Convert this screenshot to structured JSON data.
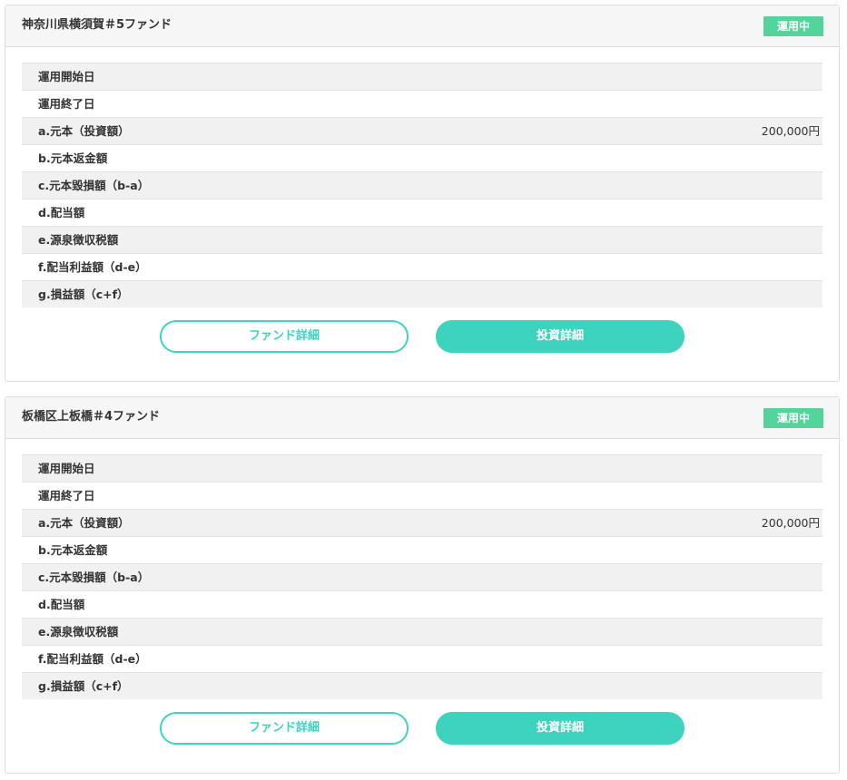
{
  "funds": [
    {
      "title": "神奈川県横須賀＃5ファンド",
      "status": "運用中",
      "rows": [
        {
          "label": "運用開始日",
          "value": ""
        },
        {
          "label": "運用終了日",
          "value": ""
        },
        {
          "label": "a.元本（投資額）",
          "value": "200,000円"
        },
        {
          "label": "b.元本返金額",
          "value": ""
        },
        {
          "label": "c.元本毀損額（b-a）",
          "value": ""
        },
        {
          "label": "d.配当額",
          "value": ""
        },
        {
          "label": "e.源泉徴収税額",
          "value": ""
        },
        {
          "label": "f.配当利益額（d-e）",
          "value": ""
        },
        {
          "label": "g.損益額（c+f）",
          "value": ""
        }
      ],
      "fund_detail_label": "ファンド詳細",
      "investment_detail_label": "投資詳細"
    },
    {
      "title": "板橋区上板橋＃4ファンド",
      "status": "運用中",
      "rows": [
        {
          "label": "運用開始日",
          "value": ""
        },
        {
          "label": "運用終了日",
          "value": ""
        },
        {
          "label": "a.元本（投資額）",
          "value": "200,000円"
        },
        {
          "label": "b.元本返金額",
          "value": ""
        },
        {
          "label": "c.元本毀損額（b-a）",
          "value": ""
        },
        {
          "label": "d.配当額",
          "value": ""
        },
        {
          "label": "e.源泉徴収税額",
          "value": ""
        },
        {
          "label": "f.配当利益額（d-e）",
          "value": ""
        },
        {
          "label": "g.損益額（c+f）",
          "value": ""
        }
      ],
      "fund_detail_label": "ファンド詳細",
      "investment_detail_label": "投資詳細"
    }
  ],
  "colors": {
    "accent": "#3dd3be",
    "status_badge": "#52d49a",
    "row_alt": "#f1f1f1"
  }
}
